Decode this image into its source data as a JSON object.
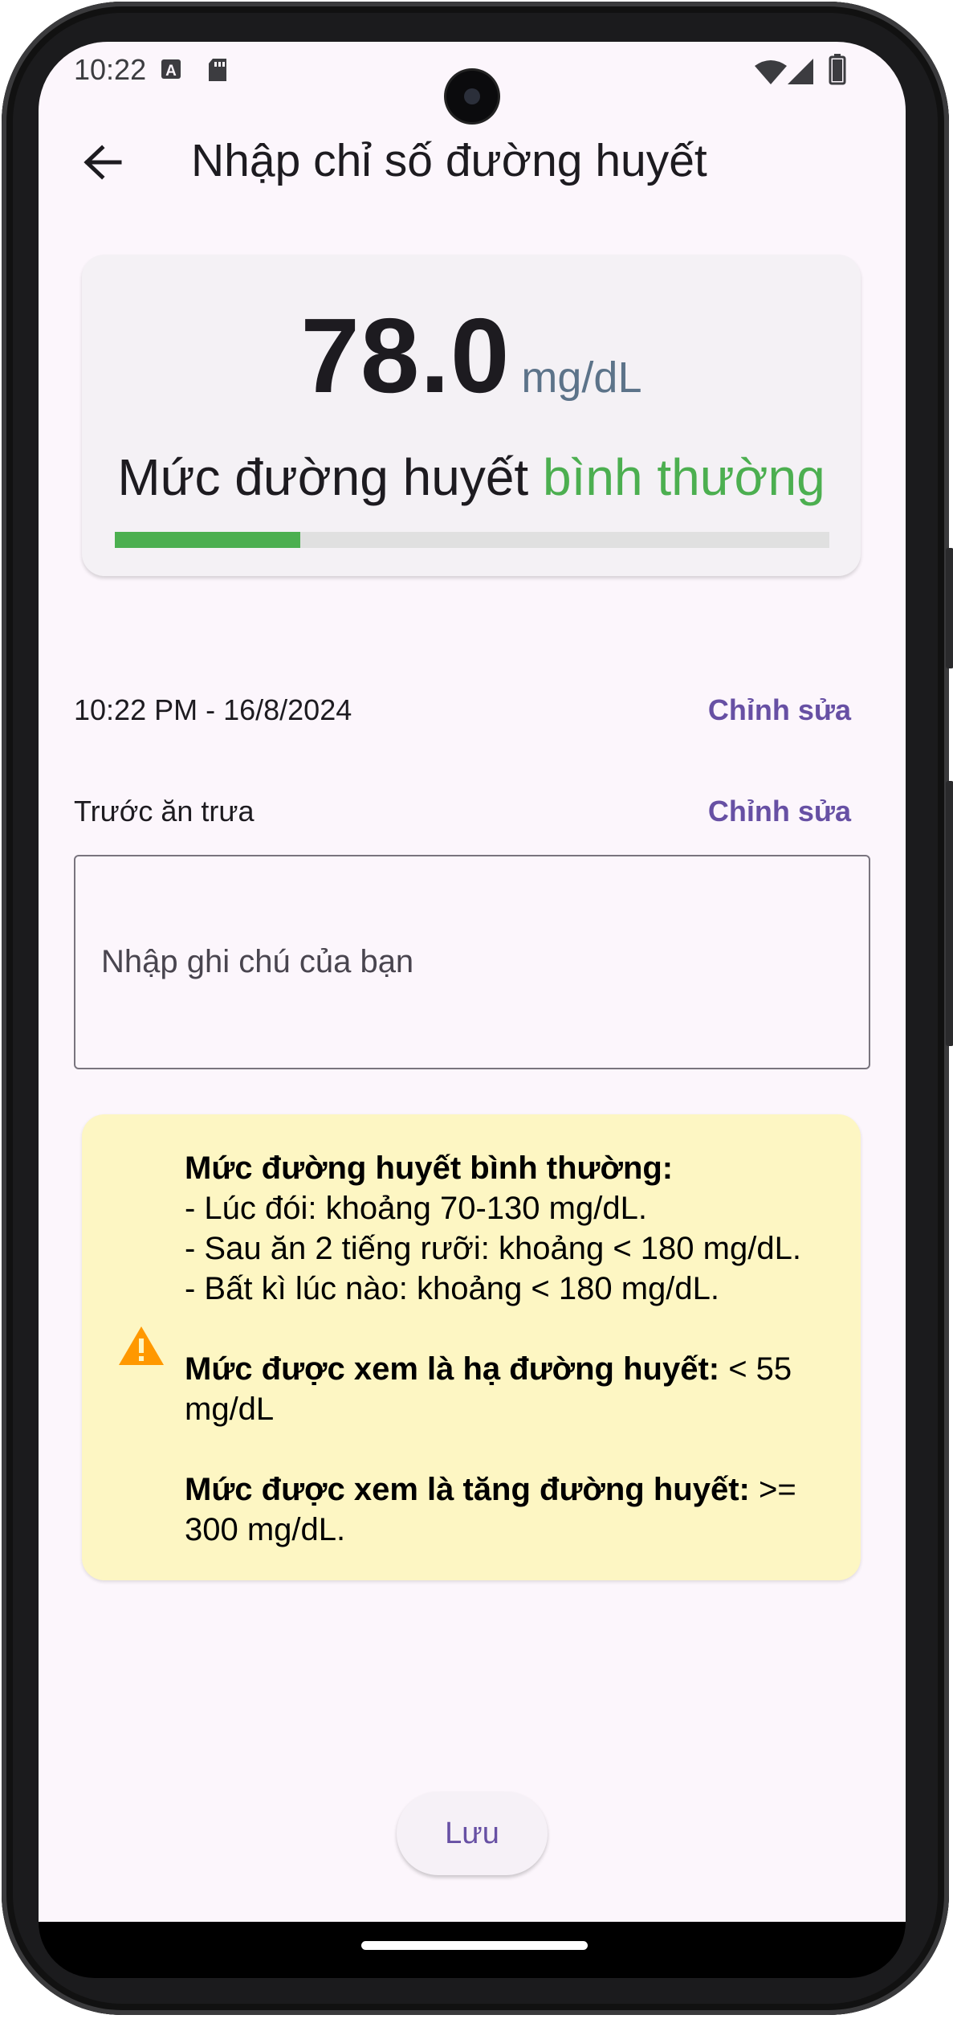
{
  "status_bar": {
    "time": "10:22",
    "icons": [
      "keyboard-a-icon",
      "sd-card-icon",
      "wifi-icon",
      "signal-icon",
      "battery-icon"
    ]
  },
  "app_bar": {
    "title": "Nhập chỉ số đường huyết",
    "back_icon": "arrow-left-icon"
  },
  "reading": {
    "value": "78.0",
    "unit": "mg/dL",
    "status_prefix": "Mức đường huyết ",
    "status_level": "bình thường",
    "level_fraction": 0.26,
    "level_color": "#4caf50"
  },
  "datetime_row": {
    "text": "10:22 PM - 16/8/2024",
    "edit_label": "Chỉnh sửa"
  },
  "meal_row": {
    "text": "Trước ăn trưa",
    "edit_label": "Chỉnh sửa"
  },
  "note": {
    "placeholder": "Nhập ghi chú của bạn",
    "value": ""
  },
  "info_box": {
    "icon": "warning-icon",
    "normal_title": "Mức đường huyết bình thường:",
    "normal_lines": [
      "- Lúc đói: khoảng 70-130 mg/dL.",
      "- Sau ăn 2 tiếng rưỡi: khoảng < 180 mg/dL.",
      "- Bất kì lúc nào: khoảng < 180 mg/dL."
    ],
    "low_title": "Mức được xem là hạ đường huyết:",
    "low_value": " < 55 mg/dL",
    "high_title": "Mức được xem là tăng đường huyết:",
    "high_value": " >= 300 mg/dL."
  },
  "save_label": "Lưu",
  "colors": {
    "accent": "#6750a4",
    "normal": "#4caf50",
    "info_background": "#fdf6c3",
    "warning": "#ff9800"
  }
}
